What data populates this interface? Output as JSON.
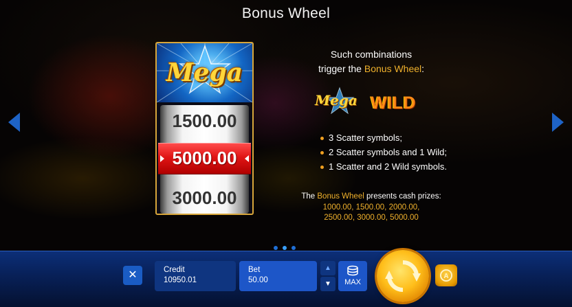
{
  "title": "Bonus Wheel",
  "reel": {
    "logo": "Mega",
    "values": [
      "1500.00",
      "5000.00",
      "3000.00"
    ]
  },
  "info": {
    "line1": "Such combinations",
    "line2_prefix": "trigger the ",
    "line2_highlight": "Bonus Wheel",
    "line2_suffix": ":",
    "logo_mega": "Mega",
    "logo_wild": "WILD",
    "bullets": [
      "3 Scatter symbols;",
      "2 Scatter symbols and 1 Wild;",
      "1 Scatter and 2 Wild symbols."
    ],
    "prizes_prefix": "The ",
    "prizes_highlight": "Bonus Wheel",
    "prizes_suffix": " presents cash prizes:",
    "prize_line1": "1000.00, 1500.00, 2000.00,",
    "prize_line2": "2500.00, 3000.00, 5000.00"
  },
  "pagination": {
    "pages": 3,
    "active": 2
  },
  "bottom_bar": {
    "close_icon": "close-icon",
    "credit_label": "Credit",
    "credit_value": "10950.01",
    "bet_label": "Bet",
    "bet_value": "50.00",
    "max_label": "MAX"
  },
  "colors": {
    "accent_blue": "#1d56c8",
    "highlight_gold": "#f0b12c",
    "reel_red": "#e01515"
  }
}
